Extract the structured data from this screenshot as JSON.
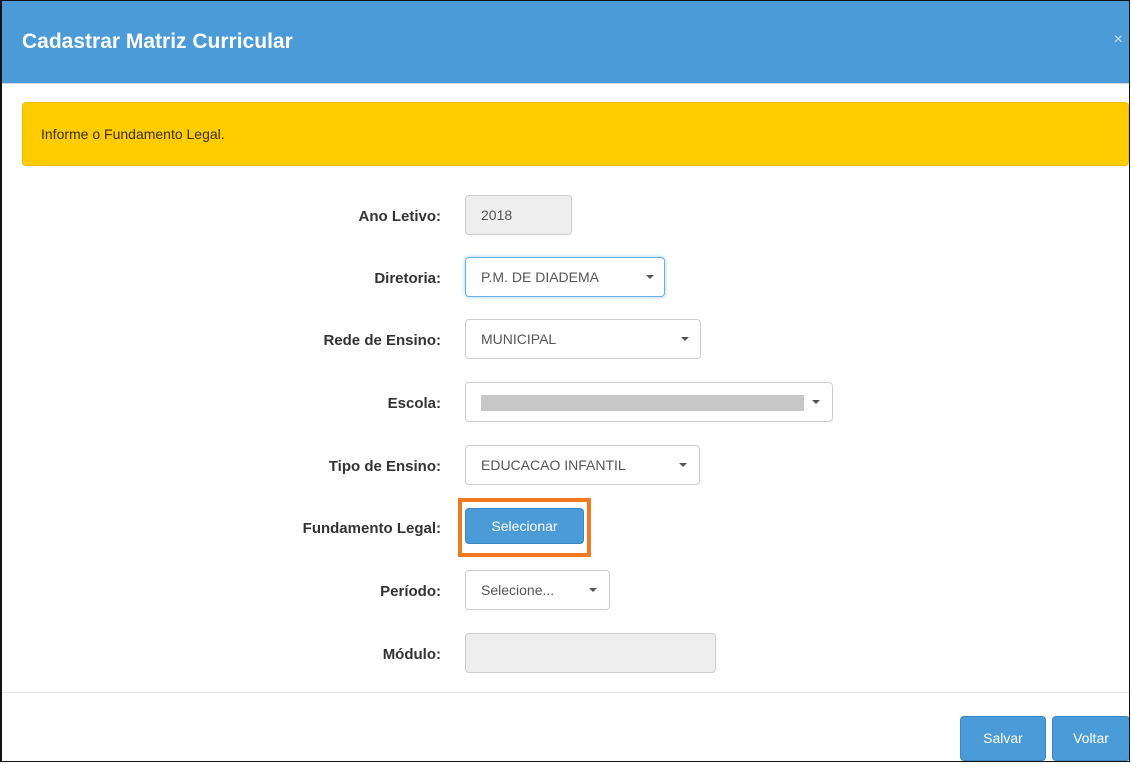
{
  "modal": {
    "title": "Cadastrar Matriz Curricular",
    "close_symbol": "×"
  },
  "alert": {
    "message": "Informe o Fundamento Legal.",
    "color": "#ffcc00"
  },
  "form": {
    "ano_letivo": {
      "label": "Ano Letivo:",
      "value": "2018",
      "disabled": true
    },
    "diretoria": {
      "label": "Diretoria:",
      "value": "P.M. DE DIADEMA"
    },
    "rede_ensino": {
      "label": "Rede de Ensino:",
      "value": "MUNICIPAL"
    },
    "escola": {
      "label": "Escola:",
      "value": ""
    },
    "tipo_ensino": {
      "label": "Tipo de Ensino:",
      "value": "EDUCACAO INFANTIL"
    },
    "fundamento_legal": {
      "label": "Fundamento Legal:",
      "button_label": "Selecionar"
    },
    "periodo": {
      "label": "Período:",
      "value": "Selecione..."
    },
    "modulo": {
      "label": "Módulo:",
      "value": "",
      "disabled": true
    }
  },
  "footer": {
    "save_label": "Salvar",
    "back_label": "Voltar"
  },
  "colors": {
    "header": "#4a9bd7",
    "primary_button": "#4a9bd7",
    "highlight": "#f37921"
  }
}
